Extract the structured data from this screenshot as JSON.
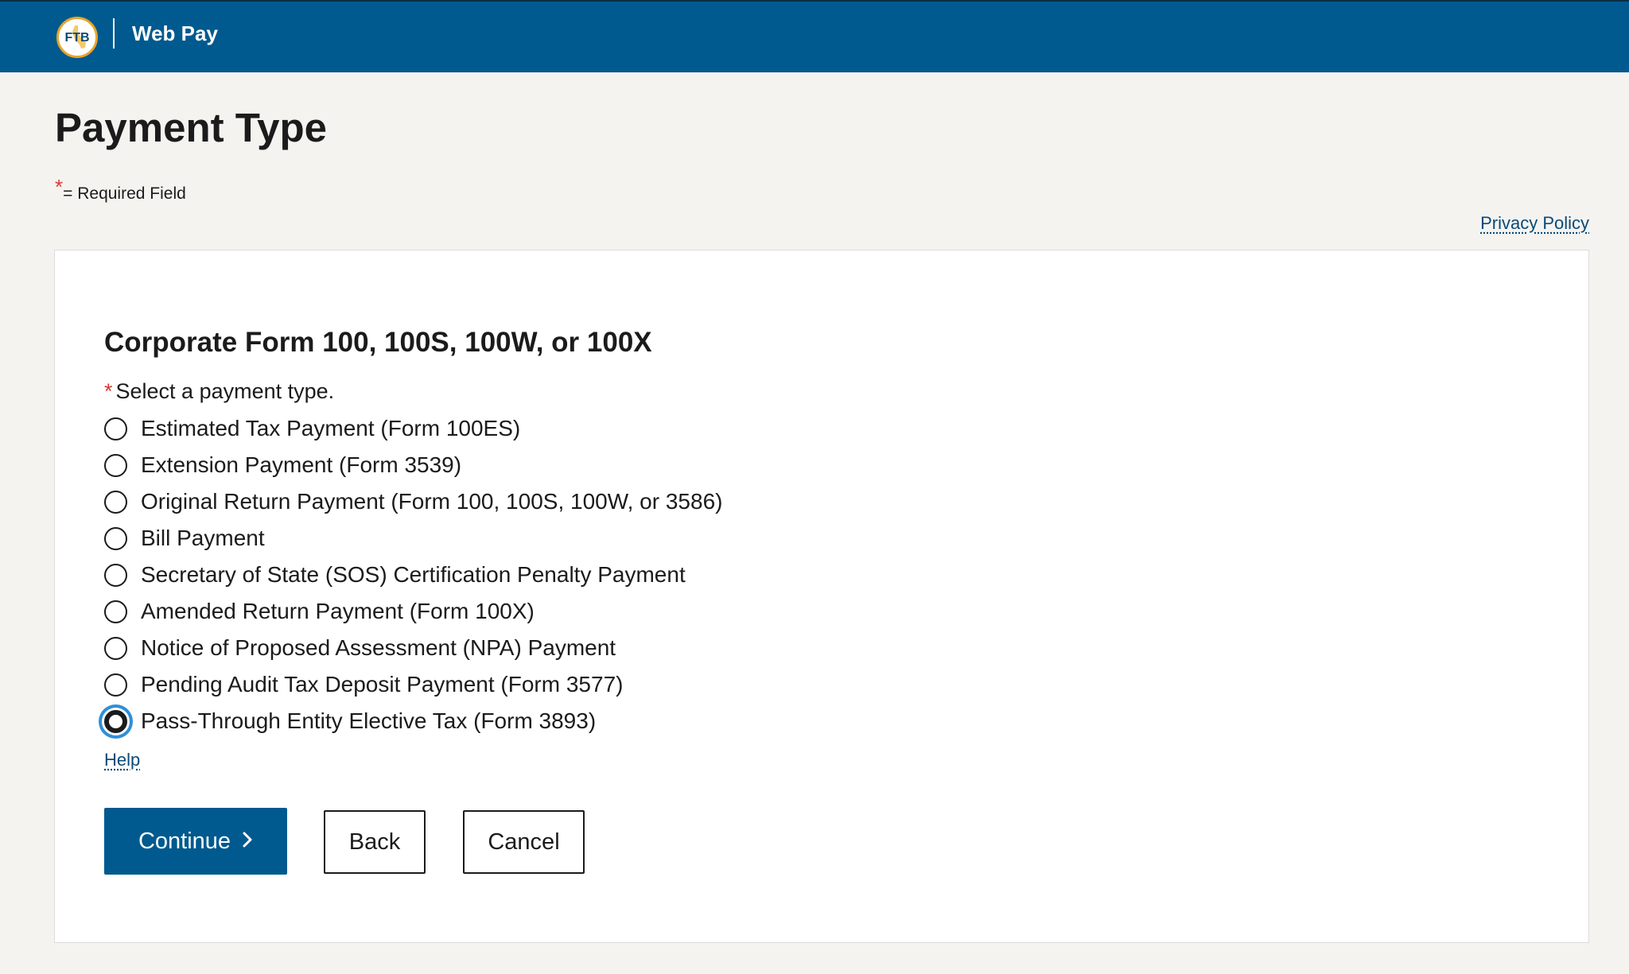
{
  "header": {
    "logo_text": "FTB",
    "app_title": "Web Pay"
  },
  "page": {
    "title": "Payment Type",
    "required_star": "*",
    "required_note": "= Required Field",
    "privacy_link": "Privacy Policy"
  },
  "form": {
    "section_title": "Corporate Form 100, 100S, 100W, or 100X",
    "question_star": "*",
    "question": "Select a payment type.",
    "options": [
      {
        "label": "Estimated Tax Payment (Form 100ES)",
        "selected": false
      },
      {
        "label": "Extension Payment (Form 3539)",
        "selected": false
      },
      {
        "label": "Original Return Payment (Form 100, 100S, 100W, or 3586)",
        "selected": false
      },
      {
        "label": "Bill Payment",
        "selected": false
      },
      {
        "label": "Secretary of State (SOS) Certification Penalty Payment",
        "selected": false
      },
      {
        "label": "Amended Return Payment (Form 100X)",
        "selected": false
      },
      {
        "label": "Notice of Proposed Assessment (NPA) Payment",
        "selected": false
      },
      {
        "label": "Pending Audit Tax Deposit Payment (Form 3577)",
        "selected": false
      },
      {
        "label": "Pass-Through Entity Elective Tax (Form 3893)",
        "selected": true
      }
    ],
    "help_link": "Help"
  },
  "buttons": {
    "continue_label": "Continue",
    "back_label": "Back",
    "cancel_label": "Cancel"
  },
  "colors": {
    "header_bg": "#005a8f",
    "primary_button": "#005a8f",
    "link": "#0a4a78",
    "required_star": "#d83933",
    "focus_ring": "#2f8fd8",
    "page_bg": "#f4f3f0"
  }
}
